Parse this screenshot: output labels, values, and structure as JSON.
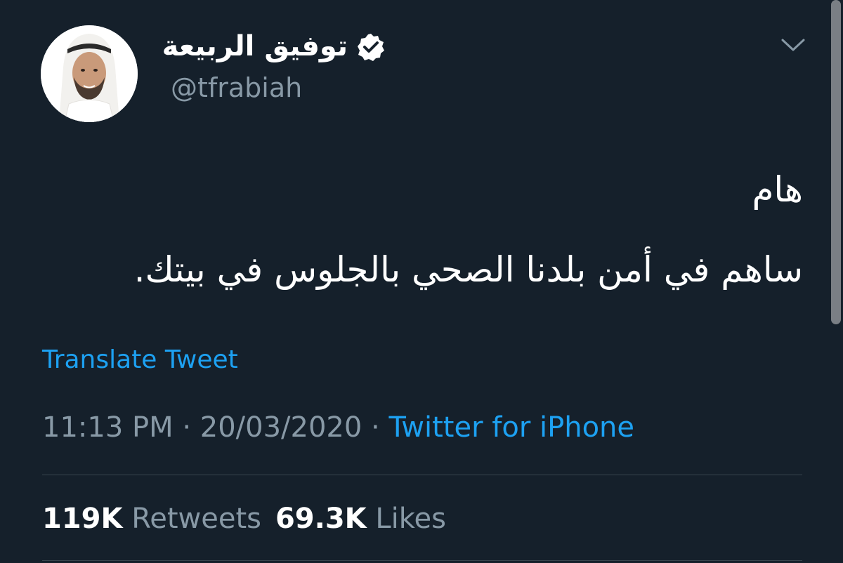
{
  "tweet": {
    "author": {
      "display_name": "توفيق الربيعة",
      "handle": "@tfrabiah",
      "verified_icon": "verified-badge-icon"
    },
    "menu_icon": "chevron-down-icon",
    "text_lines": [
      "هام",
      "ساهم في أمن بلدنا الصحي بالجلوس في بيتك."
    ],
    "translate_label": "Translate Tweet",
    "time": "11:13 PM",
    "date": "20/03/2020",
    "separator": "·",
    "source": "Twitter for iPhone",
    "stats": {
      "retweets_count": "119K",
      "retweets_label": "Retweets",
      "likes_count": "69.3K",
      "likes_label": "Likes"
    }
  },
  "colors": {
    "background": "#15202b",
    "text": "#ffffff",
    "secondary_text": "#8899a6",
    "link": "#1da1f2",
    "divider": "#38444d"
  }
}
